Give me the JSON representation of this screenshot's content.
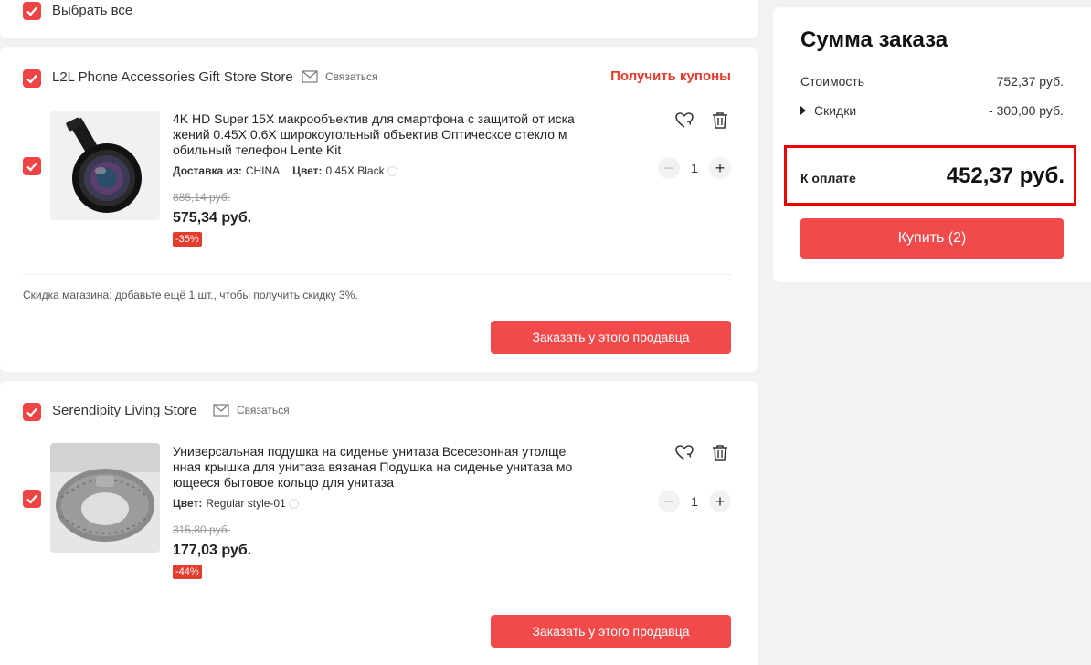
{
  "select_all": {
    "label": "Выбрать все"
  },
  "stores": [
    {
      "name": "L2L Phone Accessories Gift Store Store",
      "contact": "Связаться",
      "coupons": "Получить купоны",
      "item": {
        "title": "4K HD Super 15X макрообъектив для смартфона с защитой от иска жений 0.45X 0.6X широкоугольный объектив Оптическое стекло м обильный телефон Lente Kit",
        "shipping_label": "Доставка из:",
        "shipping_value": "CHINA",
        "color_label": "Цвет:",
        "color_value": "0.45X Black",
        "old_price": "885,14 руб.",
        "price": "575,34 руб.",
        "discount": "-35%",
        "quantity": "1",
        "icon": "camera-lens-image"
      },
      "discount_note": "Скидка магазина:  добавьте ещё 1 шт., чтобы получить скидку 3%.",
      "order_button": "Заказать у этого продавца"
    },
    {
      "name": "Serendipity Living Store",
      "contact": "Связаться",
      "item": {
        "title": "Универсальная подушка на сиденье унитаза Всесезонная утолще нная крышка для унитаза вязаная Подушка на сиденье унитаза мо ющееся бытовое кольцо для унитаза",
        "color_label": "Цвет:",
        "color_value": "Regular style-01",
        "old_price": "315,80 руб.",
        "price": "177,03 руб.",
        "discount": "-44%",
        "quantity": "1",
        "icon": "toilet-seat-cushion-image"
      },
      "order_button": "Заказать у этого продавца"
    }
  ],
  "summary": {
    "title": "Сумма заказа",
    "cost_label": "Стоимость",
    "cost_value": "752,37 руб.",
    "discounts_label": "Скидки",
    "discounts_value": "- 300,00 руб.",
    "pay_label": "К оплате",
    "pay_value": "452,37 руб.",
    "buy_button": "Купить (2)"
  },
  "colors": {
    "accent": "#f24a4a",
    "price_red": "#e43c2d",
    "highlight_border": "#ee0000"
  }
}
